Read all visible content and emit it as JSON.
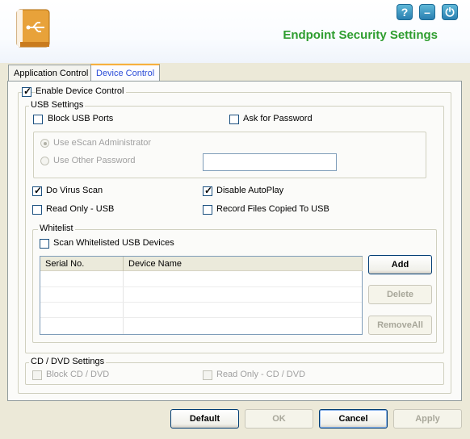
{
  "header": {
    "title": "Endpoint Security Settings"
  },
  "window_controls": {
    "help": "?",
    "minimize": "–",
    "power": "⏻"
  },
  "tabs": [
    {
      "label": "Application Control"
    },
    {
      "label": "Device Control"
    }
  ],
  "device_control": {
    "enable_label": "Enable Device Control",
    "usb_settings": {
      "legend": "USB Settings",
      "block_usb": "Block USB Ports",
      "ask_password": "Ask for Password",
      "use_escan_admin": "Use eScan Administrator",
      "use_other_password": "Use Other Password",
      "do_virus_scan": "Do Virus Scan",
      "disable_autoplay": "Disable AutoPlay",
      "read_only_usb": "Read Only - USB",
      "record_files": "Record Files Copied To USB"
    },
    "whitelist": {
      "legend": "Whitelist",
      "scan_whitelisted": "Scan Whitelisted USB Devices",
      "columns": [
        "Serial No.",
        "Device Name"
      ],
      "add": "Add",
      "delete": "Delete",
      "remove_all": "RemoveAll"
    },
    "cd_dvd": {
      "legend": "CD / DVD Settings",
      "block_cd": "Block CD / DVD",
      "read_only_cd": "Read Only - CD / DVD"
    }
  },
  "footer": {
    "default": "Default",
    "ok": "OK",
    "cancel": "Cancel",
    "apply": "Apply"
  }
}
